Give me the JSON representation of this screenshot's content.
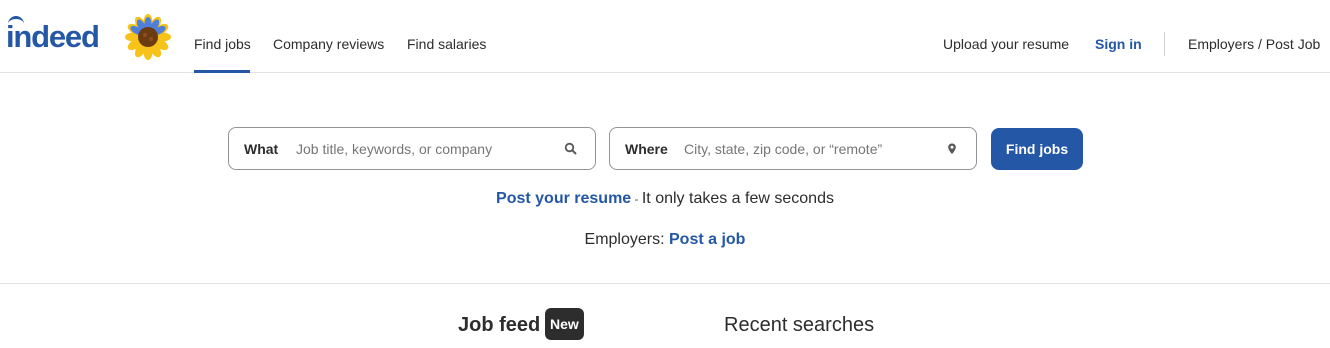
{
  "header": {
    "logo_text": "indeed",
    "nav": {
      "find_jobs": "Find jobs",
      "company_reviews": "Company reviews",
      "find_salaries": "Find salaries"
    },
    "right": {
      "upload_resume": "Upload your resume",
      "sign_in": "Sign in",
      "employers": "Employers / Post Job"
    }
  },
  "search": {
    "what_label": "What",
    "what_placeholder": "Job title, keywords, or company",
    "where_label": "Where",
    "where_placeholder": "City, state, zip code, or “remote”",
    "button_label": "Find jobs"
  },
  "promo": {
    "resume_link": "Post your resume",
    "resume_dash": " - ",
    "resume_text": "It only takes a few seconds",
    "employers_prefix": "Employers: ",
    "post_job_link": "Post a job"
  },
  "tabs": {
    "job_feed": "Job feed",
    "new_badge": "New",
    "recent_searches": "Recent searches"
  },
  "colors": {
    "brand": "#2557a7",
    "text": "#2d2d2d",
    "divider": "#e4e2e0"
  }
}
